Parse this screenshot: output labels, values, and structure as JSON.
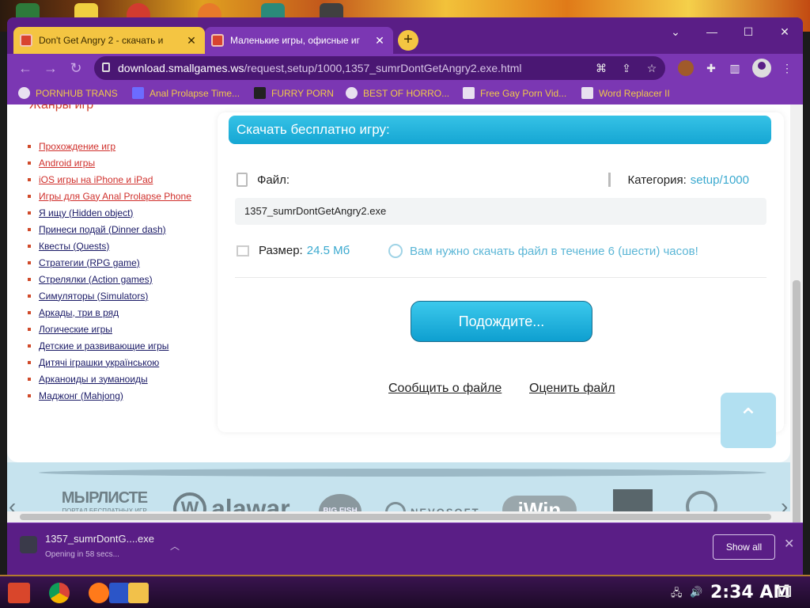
{
  "browser": {
    "tabs": [
      {
        "title": "Don't Get Angry 2 - скачать и",
        "active": false
      },
      {
        "title": "Маленькие игры, офисные иг",
        "active": true
      }
    ],
    "url_host": "download.smallgames.ws",
    "url_path": "/request,setup/1000,1357_sumrDontGetAngry2.exe.html",
    "bookmarks": [
      "PORNHUB TRANS",
      "Anal Prolapse Time...",
      "FURRY PORN",
      "BEST OF HORRO...",
      "Free Gay Porn Vid...",
      "Word Replacer II"
    ]
  },
  "sidebar": {
    "title": "Жанры игр",
    "genres": [
      "Прохождение игр",
      "Android игры",
      "iOS игры на iPhone и iPad",
      "Игры для Gay Anal Prolapse Phone",
      "Я ищу (Hidden object)",
      "Принеси подай (Dinner dash)",
      "Квесты (Quests)",
      "Стратегии (RPG game)",
      "Стрелялки (Action games)",
      "Симуляторы (Simulators)",
      "Аркады, три в ряд",
      "Логические игры",
      "Детские и развивающие игры",
      "Дитячі іграшки українською",
      "Арканоиды и зуманоиды",
      "Маджонг (Mahjong)"
    ]
  },
  "download": {
    "header": "Скачать бесплатно игру:",
    "file_label": "Файл:",
    "category_label": "Категория:",
    "category_value": "setup/1000",
    "filename": "1357_sumrDontGetAngry2.exe",
    "size_label": "Размер:",
    "size_value": "24.5 Мб",
    "notice": "Вам нужно скачать файл в течение 6 (шести) часов!",
    "wait_button": "Подождите...",
    "report_link": "Сообщить о файле",
    "rate_link": "Оценить файл"
  },
  "partners": {
    "logo1_top": "МЫРЛИСТЕ",
    "logo1_sub": "ПОРТАЛ БЕСПЛАТНЫХ ИГР",
    "logo2": "alawar",
    "logo3": "BIG FISH",
    "logo4": "NEVOSOFT",
    "logo5": "iWin"
  },
  "downloads_bar": {
    "file": "1357_sumrDontG....exe",
    "status": "Opening in 58 secs...",
    "show_all": "Show all"
  },
  "taskbar": {
    "time": "2:34 AM"
  },
  "colors": {
    "browser_frame": "#5a1e86",
    "toolbar": "#7b37b3",
    "inactive_tab": "#f4c542",
    "accent_blue": "#15a6d3",
    "link_red": "#d0302c"
  }
}
